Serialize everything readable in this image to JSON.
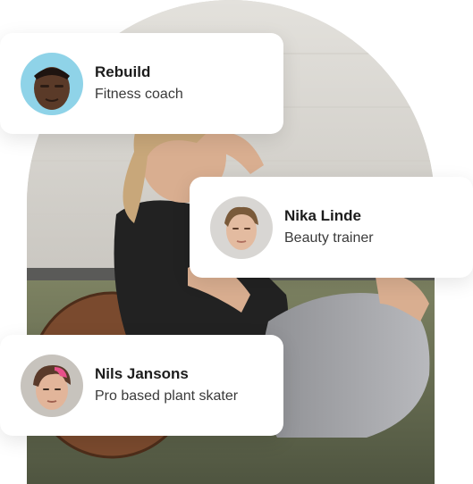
{
  "profiles": [
    {
      "name": "Rebuild",
      "role": "Fitness coach",
      "avatar_icon": "man-portrait-icon"
    },
    {
      "name": "Nika Linde",
      "role": "Beauty trainer",
      "avatar_icon": "woman-portrait-icon"
    },
    {
      "name": "Nils Jansons",
      "role": "Pro based plant skater",
      "avatar_icon": "pink-hair-portrait-icon"
    }
  ],
  "colors": {
    "card_bg": "#ffffff",
    "name_text": "#1c1c1c",
    "role_text": "#3a3a3a",
    "wall": "#d7d5d0",
    "turf": "#6b7152"
  }
}
